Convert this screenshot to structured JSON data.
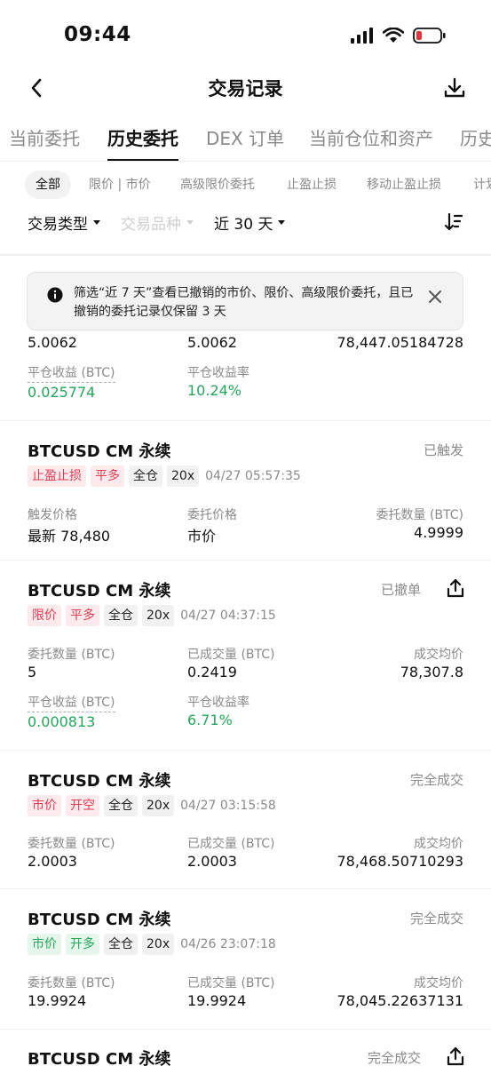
{
  "status_bar": {
    "time": "09:44"
  },
  "header": {
    "title": "交易记录"
  },
  "main_tabs": [
    "当前委托",
    "历史委托",
    "DEX 订单",
    "当前仓位和资产",
    "历史"
  ],
  "filter_chips": [
    "全部",
    "限价 | 市价",
    "高级限价委托",
    "止盈止损",
    "移动止盈止损",
    "计划"
  ],
  "dropdowns": {
    "trade_type": "交易类型",
    "symbol": "交易品种",
    "period": "近 30 天"
  },
  "notice": {
    "text": "筛选“近 7 天”查看已撤销的市价、限价、高级限价委托，且已撤销的委托记录仅保留 3 天"
  },
  "partial_card": {
    "values": [
      "5.0062",
      "5.0062",
      "78,447.05184728"
    ],
    "pnl_label": "平仓收益 (BTC)",
    "pnl_value": "0.025774",
    "pnl_rate_label": "平仓收益率",
    "pnl_rate_value": "10.24%"
  },
  "cards": [
    {
      "title": "BTCUSD CM 永续",
      "status": "已触发",
      "tags": [
        "止盈止损",
        "平多",
        "全仓",
        "20x"
      ],
      "time": "04/27 05:57:35",
      "fields": [
        {
          "label": "触发价格",
          "value": "最新 78,480"
        },
        {
          "label": "委托价格",
          "value": "市价"
        },
        {
          "label": "委托数量 (BTC)",
          "value": "4.9999"
        }
      ]
    },
    {
      "title": "BTCUSD CM 永续",
      "status": "已撤单",
      "tags": [
        "限价",
        "平多",
        "全仓",
        "20x"
      ],
      "time": "04/27 04:37:15",
      "fields": [
        {
          "label": "委托数量 (BTC)",
          "value": "5"
        },
        {
          "label": "已成交量 (BTC)",
          "value": "0.2419"
        },
        {
          "label": "成交均价",
          "value": "78,307.8"
        }
      ],
      "pnl_label": "平仓收益 (BTC)",
      "pnl_value": "0.000813",
      "pnl_rate_label": "平仓收益率",
      "pnl_rate_value": "6.71%"
    },
    {
      "title": "BTCUSD CM 永续",
      "status": "完全成交",
      "tags": [
        "市价",
        "开空",
        "全仓",
        "20x"
      ],
      "time": "04/27 03:15:58",
      "fields": [
        {
          "label": "委托数量 (BTC)",
          "value": "2.0003"
        },
        {
          "label": "已成交量 (BTC)",
          "value": "2.0003"
        },
        {
          "label": "成交均价",
          "value": "78,468.50710293"
        }
      ]
    },
    {
      "title": "BTCUSD CM 永续",
      "status": "完全成交",
      "tags": [
        "市价",
        "开多",
        "全仓",
        "20x"
      ],
      "time": "04/26 23:07:18",
      "fields": [
        {
          "label": "委托数量 (BTC)",
          "value": "19.9924"
        },
        {
          "label": "已成交量 (BTC)",
          "value": "19.9924"
        },
        {
          "label": "成交均价",
          "value": "78,045.22637131"
        }
      ]
    },
    {
      "title": "BTCUSD CM 永续",
      "status": "完全成交"
    }
  ],
  "colors": {
    "green": "#25a65a",
    "red": "#e03c55",
    "muted": "#8a8a8a"
  }
}
